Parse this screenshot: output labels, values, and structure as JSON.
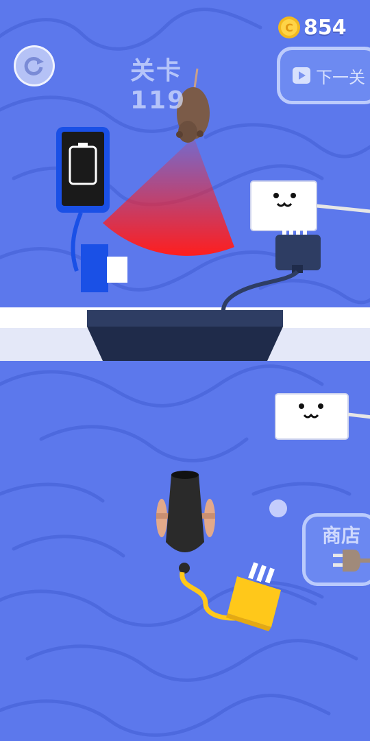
{
  "hud": {
    "coins": "854",
    "level_label": "关卡 119",
    "next_level_label": "下一关",
    "shop_label": "商店"
  },
  "colors": {
    "background": "#5c78ec",
    "swirl": "#4f6ae0",
    "counter_top": "#ffffff",
    "counter_front": "#e6e9f8",
    "stove_dark": "#1f2b4a",
    "vision_cone": "#ff1e1e",
    "phone_blue": "#1a50e6",
    "plug_yellow": "#ffc81a",
    "cannon_black": "#2a2a2a"
  },
  "icons": [
    "coin-icon",
    "restart-icon",
    "play-icon",
    "plug-icon",
    "empty-battery-icon"
  ]
}
